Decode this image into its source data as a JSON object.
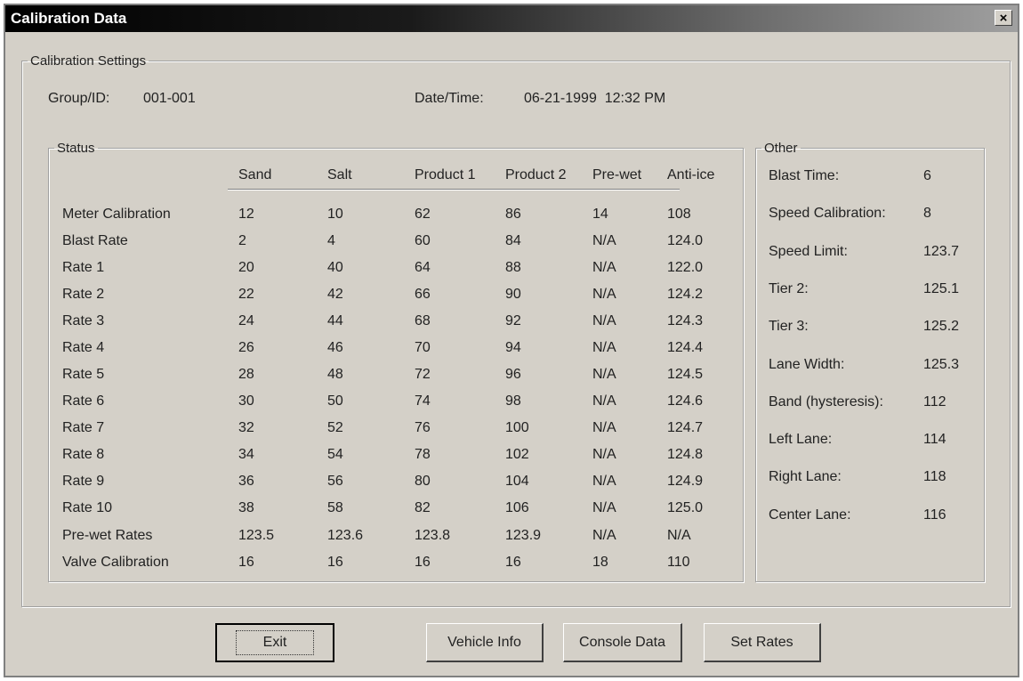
{
  "window": {
    "title": "Calibration Data",
    "close_label": "×"
  },
  "settings": {
    "legend": "Calibration Settings",
    "group_label": "Group/ID:",
    "group_value": "001-001",
    "datetime_label": "Date/Time:",
    "datetime_value": "06-21-1999  12:32 PM"
  },
  "status": {
    "legend": "Status",
    "columns": [
      "Sand",
      "Salt",
      "Product 1",
      "Product 2",
      "Pre-wet",
      "Anti-ice"
    ],
    "rows": [
      {
        "label": "Meter Calibration",
        "values": [
          "12",
          "10",
          "62",
          "86",
          "14",
          "108"
        ]
      },
      {
        "label": "Blast Rate",
        "values": [
          "2",
          "4",
          "60",
          "84",
          "N/A",
          "124.0"
        ]
      },
      {
        "label": "Rate 1",
        "values": [
          "20",
          "40",
          "64",
          "88",
          "N/A",
          "122.0"
        ]
      },
      {
        "label": "Rate 2",
        "values": [
          "22",
          "42",
          "66",
          "90",
          "N/A",
          "124.2"
        ]
      },
      {
        "label": "Rate 3",
        "values": [
          "24",
          "44",
          "68",
          "92",
          "N/A",
          "124.3"
        ]
      },
      {
        "label": "Rate 4",
        "values": [
          "26",
          "46",
          "70",
          "94",
          "N/A",
          "124.4"
        ]
      },
      {
        "label": "Rate 5",
        "values": [
          "28",
          "48",
          "72",
          "96",
          "N/A",
          "124.5"
        ]
      },
      {
        "label": "Rate 6",
        "values": [
          "30",
          "50",
          "74",
          "98",
          "N/A",
          "124.6"
        ]
      },
      {
        "label": "Rate 7",
        "values": [
          "32",
          "52",
          "76",
          "100",
          "N/A",
          "124.7"
        ]
      },
      {
        "label": "Rate 8",
        "values": [
          "34",
          "54",
          "78",
          "102",
          "N/A",
          "124.8"
        ]
      },
      {
        "label": "Rate 9",
        "values": [
          "36",
          "56",
          "80",
          "104",
          "N/A",
          "124.9"
        ]
      },
      {
        "label": "Rate 10",
        "values": [
          "38",
          "58",
          "82",
          "106",
          "N/A",
          "125.0"
        ]
      },
      {
        "label": "Pre-wet Rates",
        "values": [
          "123.5",
          "123.6",
          "123.8",
          "123.9",
          "N/A",
          "N/A"
        ]
      },
      {
        "label": "Valve Calibration",
        "values": [
          "16",
          "16",
          "16",
          "16",
          "18",
          "110"
        ]
      }
    ]
  },
  "other": {
    "legend": "Other",
    "items": [
      {
        "label": "Blast Time:",
        "value": "6"
      },
      {
        "label": "Speed Calibration:",
        "value": "8"
      },
      {
        "label": "Speed Limit:",
        "value": "123.7"
      },
      {
        "label": "Tier 2:",
        "value": "125.1"
      },
      {
        "label": "Tier 3:",
        "value": "125.2"
      },
      {
        "label": "Lane Width:",
        "value": "125.3"
      },
      {
        "label": "Band (hysteresis):",
        "value": "112"
      },
      {
        "label": "Left Lane:",
        "value": "114"
      },
      {
        "label": "Right Lane:",
        "value": "118"
      },
      {
        "label": "Center Lane:",
        "value": "116"
      }
    ]
  },
  "buttons": {
    "exit": "Exit",
    "vehicle_info": "Vehicle Info",
    "console_data": "Console Data",
    "set_rates": "Set Rates"
  }
}
